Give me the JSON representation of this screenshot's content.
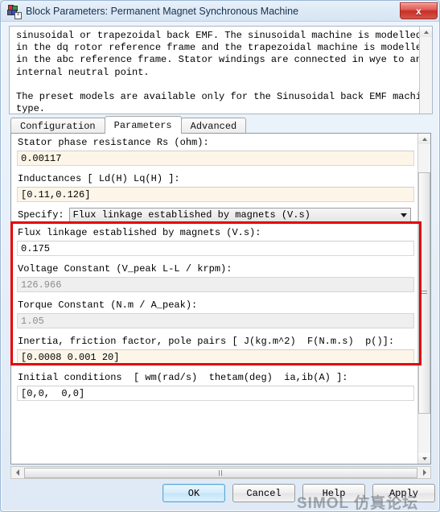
{
  "window": {
    "title": "Block Parameters: Permanent Magnet Synchronous Machine",
    "icon": "block-icon",
    "close_label": "x"
  },
  "description": {
    "text": "sinusoidal or trapezoidal back EMF. The sinusoidal machine is modelled\nin the dq rotor reference frame and the trapezoidal machine is modelled\nin the abc reference frame. Stator windings are connected in wye to an\ninternal neutral point.\n\nThe preset models are available only for the Sinusoidal back EMF machine\ntype."
  },
  "tabs": [
    {
      "label": "Configuration",
      "active": false
    },
    {
      "label": "Parameters",
      "active": true
    },
    {
      "label": "Advanced",
      "active": false
    }
  ],
  "parameters": {
    "stator_resistance": {
      "label": "Stator phase resistance Rs (ohm):",
      "value": "0.00117"
    },
    "inductances": {
      "label": "Inductances [ Ld(H) Lq(H) ]:",
      "value": "[0.11,0.126]"
    },
    "specify": {
      "label": "Specify:",
      "value": "Flux linkage established by magnets (V.s)",
      "options": [
        "Flux linkage established by magnets (V.s)",
        "Voltage Constant (V_peak L-L / krpm)",
        "Torque Constant (N.m / A_peak)"
      ]
    },
    "flux_linkage": {
      "label": "Flux linkage established by magnets (V.s):",
      "value": "0.175",
      "disabled": false
    },
    "voltage_constant": {
      "label": "Voltage Constant (V_peak L-L / krpm):",
      "value": "126.966",
      "disabled": true
    },
    "torque_constant": {
      "label": "Torque Constant (N.m / A_peak):",
      "value": "1.05",
      "disabled": true
    },
    "inertia": {
      "label": "Inertia, friction factor, pole pairs [ J(kg.m^2)  F(N.m.s)  p()]:",
      "value": "[0.0008 0.001 20]"
    },
    "initial_conditions": {
      "label": "Initial conditions  [ wm(rad/s)  thetam(deg)  ia,ib(A) ]:",
      "value": "[0,0,  0,0]"
    }
  },
  "highlight": {
    "color": "#e60000"
  },
  "buttons": {
    "ok": "OK",
    "cancel": "Cancel",
    "help": "Help",
    "apply": "Apply"
  },
  "watermark": {
    "text": "SIMOL 仿真论坛"
  }
}
